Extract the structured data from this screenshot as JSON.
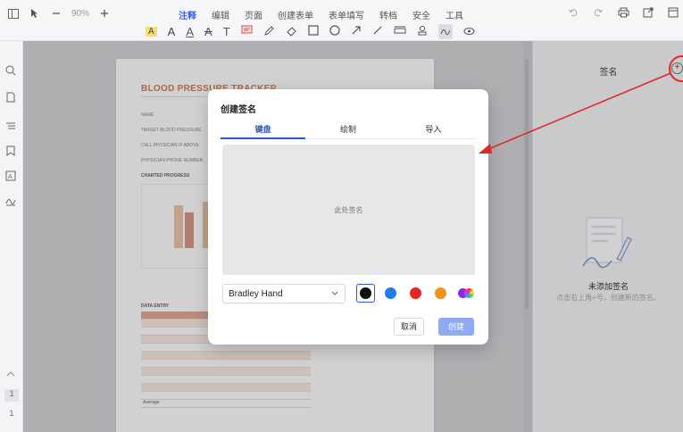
{
  "toolbar": {
    "zoom": "90%",
    "tabs": [
      "注释",
      "编辑",
      "页面",
      "创建表单",
      "表单填写",
      "转档",
      "安全",
      "工具"
    ],
    "active_tab": "注释"
  },
  "document": {
    "title": "BLOOD PRESSURE TRACKER",
    "lines": [
      "NAME",
      "TARGET BLOOD PRESSURE",
      "CALL PHYSICIAN IF ABOVE",
      "PHYSICIAN PHONE NUMBER",
      "CHARTED PROGRESS"
    ],
    "table_title": "DATA ENTRY",
    "table_footer": "Average"
  },
  "rail": {
    "page_current": "1",
    "page_total": "1"
  },
  "panel": {
    "title": "签名",
    "add_icon": "plus-circle-icon",
    "empty_title": "未添加签名",
    "empty_subtitle": "点击右上角+号，创建新的签名。"
  },
  "dialog": {
    "title": "创建签名",
    "tabs": [
      "键盘",
      "绘制",
      "导入"
    ],
    "active_tab": "键盘",
    "placeholder": "此处签名",
    "font_value": "Bradley Hand",
    "colors": [
      "#111111",
      "#1f7be8",
      "#e82424",
      "#f0951c",
      "#8a2be2"
    ],
    "selected_color": "#111111",
    "cancel_label": "取消",
    "create_label": "创建"
  },
  "colors": {
    "accent": "#2e57c9",
    "annotation_arrow": "#e02828"
  }
}
